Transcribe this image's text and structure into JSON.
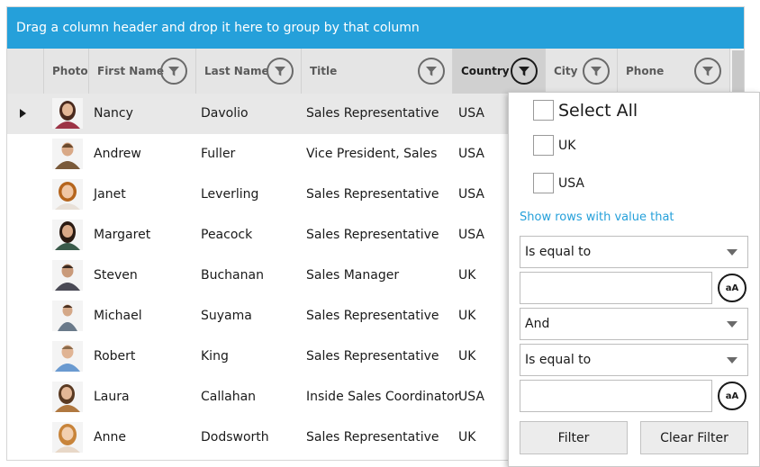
{
  "group_panel": {
    "text": "Drag a column header and drop it here to group by that column"
  },
  "columns": [
    {
      "label": "Photo"
    },
    {
      "label": "First Name"
    },
    {
      "label": "Last Name"
    },
    {
      "label": "Title"
    },
    {
      "label": "Country"
    },
    {
      "label": "City"
    },
    {
      "label": "Phone"
    }
  ],
  "rows": [
    {
      "first": "Nancy",
      "last": "Davolio",
      "title": "Sales Representative",
      "country": "USA"
    },
    {
      "first": "Andrew",
      "last": "Fuller",
      "title": "Vice President, Sales",
      "country": "USA"
    },
    {
      "first": "Janet",
      "last": "Leverling",
      "title": "Sales Representative",
      "country": "USA"
    },
    {
      "first": "Margaret",
      "last": "Peacock",
      "title": "Sales Representative",
      "country": "USA"
    },
    {
      "first": "Steven",
      "last": "Buchanan",
      "title": "Sales Manager",
      "country": "UK"
    },
    {
      "first": "Michael",
      "last": "Suyama",
      "title": "Sales Representative",
      "country": "UK"
    },
    {
      "first": "Robert",
      "last": "King",
      "title": "Sales Representative",
      "country": "UK"
    },
    {
      "first": "Laura",
      "last": "Callahan",
      "title": "Inside Sales Coordinator",
      "country": "USA"
    },
    {
      "first": "Anne",
      "last": "Dodsworth",
      "title": "Sales Representative",
      "country": "UK"
    }
  ],
  "filter_popup": {
    "select_all": "Select All",
    "values": [
      "UK",
      "USA"
    ],
    "caption": "Show rows with value that",
    "operator1": "Is equal to",
    "value1": "",
    "logic": "And",
    "operator2": "Is equal to",
    "value2": "",
    "case_label": "aA",
    "filter_label": "Filter",
    "clear_label": "Clear Filter"
  },
  "colors": {
    "accent": "#25a0da",
    "header_bg": "#e5e5e5",
    "selected_row": "#e8e8e8"
  }
}
